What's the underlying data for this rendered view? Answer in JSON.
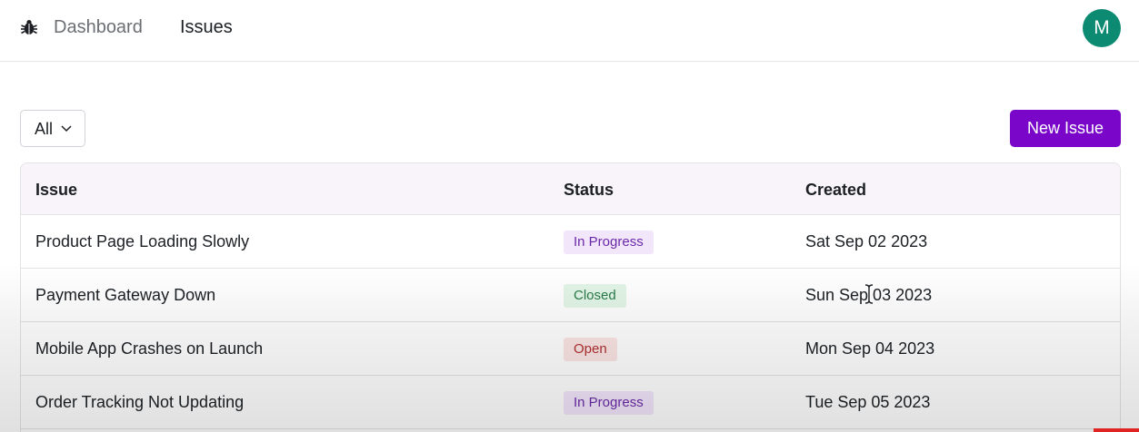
{
  "navbar": {
    "logo_icon": "bug-icon",
    "links": [
      {
        "label": "Dashboard",
        "active": false
      },
      {
        "label": "Issues",
        "active": true
      }
    ],
    "avatar_initial": "M",
    "avatar_color": "#0d8a72"
  },
  "toolbar": {
    "filter_value": "All",
    "new_issue_label": "New Issue",
    "accent_color": "#7a06c9"
  },
  "table": {
    "headers": [
      "Issue",
      "Status",
      "Created"
    ],
    "rows": [
      {
        "title": "Product Page Loading Slowly",
        "status": "In Progress",
        "status_kind": "progress",
        "created": "Sat Sep 02 2023"
      },
      {
        "title": "Payment Gateway Down",
        "status": "Closed",
        "status_kind": "closed",
        "created": "Sun Sep 03 2023"
      },
      {
        "title": "Mobile App Crashes on Launch",
        "status": "Open",
        "status_kind": "open",
        "created": "Mon Sep 04 2023"
      },
      {
        "title": "Order Tracking Not Updating",
        "status": "In Progress",
        "status_kind": "progress",
        "created": "Tue Sep 05 2023"
      }
    ]
  }
}
